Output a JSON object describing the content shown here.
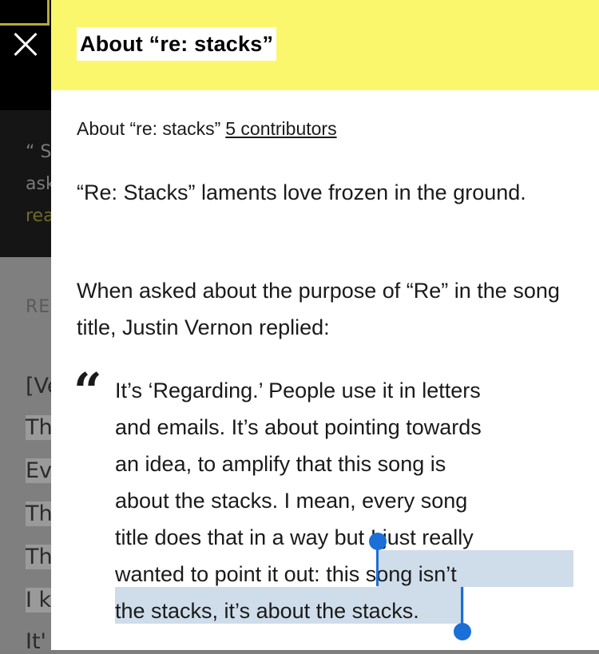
{
  "background": {
    "band_lines": [
      "“ S",
      "ask",
      "rea"
    ],
    "section_label": "RE",
    "lyric_lines": [
      "[Ve",
      "Th",
      "Ev",
      "Th",
      "Th",
      "I k",
      "It'"
    ]
  },
  "panel": {
    "title": "About “re: stacks”",
    "about_label": "About “re: stacks”",
    "contributors": "5 contributors",
    "paragraph1": "“Re: Stacks” laments love frozen in the ground.",
    "paragraph2": "When asked about the purpose of “Re” in the song title, Justin Vernon replied:",
    "quote_lines": [
      "It’s ‘Regarding.’ People use it in letters",
      "and emails. It’s about pointing towards",
      "an idea, to amplify that this song is",
      "about the stacks. I mean, every song",
      "title does that in a way but I just really"
    ],
    "quote_line6_plain": "wanted to point it out: ",
    "quote_line6_selected": "this song isn’t",
    "quote_line7_selected": "the stacks, it’s about the stacks",
    "quote_line7_plain": ".",
    "close_icon": "close-icon",
    "quote_icon": "quote-icon"
  },
  "colors": {
    "header_yellow": "#fbf76d",
    "selection": "#cfdcea",
    "selection_handle": "#1b6fd6"
  }
}
